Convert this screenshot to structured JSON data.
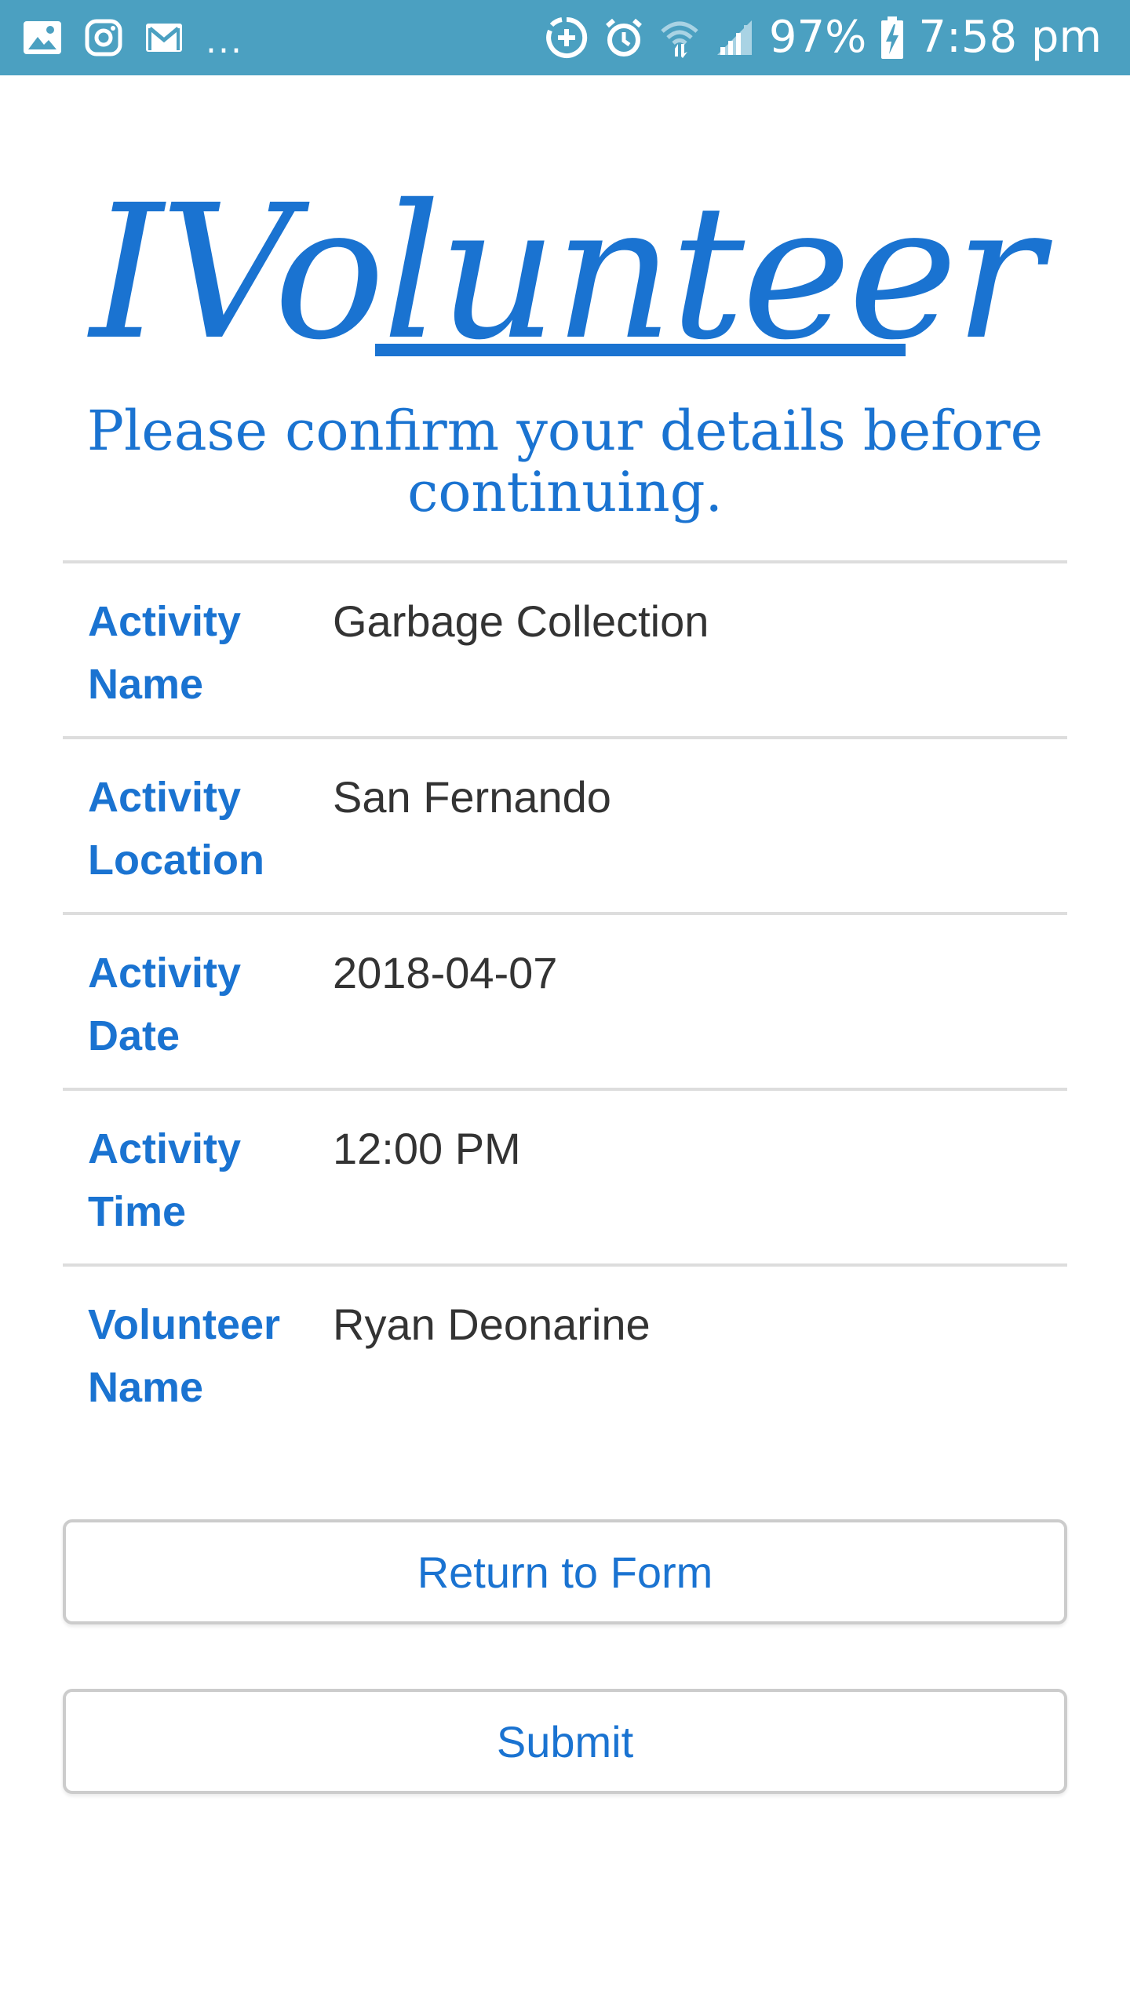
{
  "status_bar": {
    "notification_icons": [
      "image-icon",
      "instagram-icon",
      "gmail-icon"
    ],
    "overflow": "...",
    "system_icons": [
      "data-saver-icon",
      "alarm-icon",
      "wifi-icon",
      "signal-icon",
      "battery-charging-icon"
    ],
    "battery": "97%",
    "time": "7:58 pm"
  },
  "header": {
    "logo": "IVolunteer",
    "subtitle": "Please confirm your details before continuing."
  },
  "details": [
    {
      "label": "Activity Name",
      "value": "Garbage Collection"
    },
    {
      "label": "Activity Location",
      "value": "San Fernando"
    },
    {
      "label": "Activity Date",
      "value": "2018-04-07"
    },
    {
      "label": "Activity Time",
      "value": "12:00 PM"
    },
    {
      "label": "Volunteer Name",
      "value": "Ryan Deonarine"
    }
  ],
  "actions": {
    "return_label": "Return to Form",
    "submit_label": "Submit"
  },
  "colors": {
    "status_bar": "#4ba0c1",
    "accent": "#1a73d1",
    "value_text": "#333333",
    "divider": "#dddddd"
  }
}
